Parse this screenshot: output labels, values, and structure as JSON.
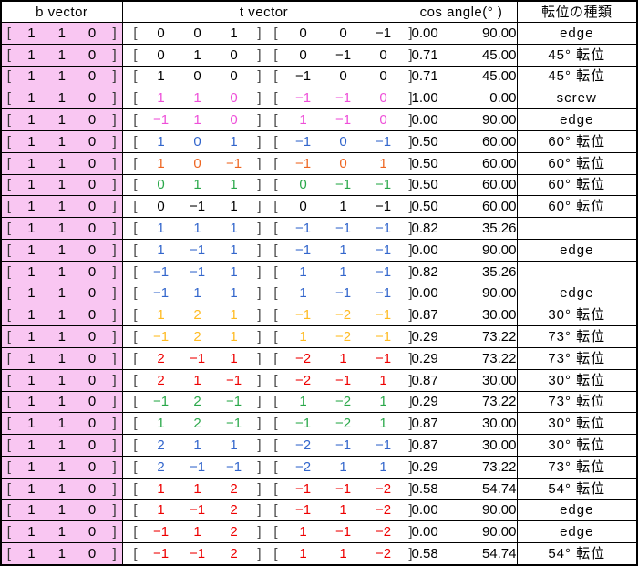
{
  "headers": {
    "b_vector": "b vector",
    "t_vector": "t vector",
    "cos_angle": "cos    angle(°   )",
    "kind": "転位の種類"
  },
  "colors": {
    "b_cell_background": "#f9c6f2",
    "black": "#000000",
    "magenta": "#ee4fd8",
    "blue": "#3366cc",
    "orange": "#ee6622",
    "green": "#2aa84a",
    "yellow": "#ffbb22",
    "red": "#ee0000"
  },
  "groups": [
    {
      "rows": [
        {
          "b": [
            "1",
            "1",
            "0"
          ],
          "t1": [
            "0",
            "0",
            "1"
          ],
          "t2": [
            "0",
            "0",
            "-1"
          ],
          "cos": "0.00",
          "angle": "90.00",
          "kind": "edge",
          "color": "k"
        },
        {
          "b": [
            "1",
            "1",
            "0"
          ],
          "t1": [
            "0",
            "1",
            "0"
          ],
          "t2": [
            "0",
            "-1",
            "0"
          ],
          "cos": "0.71",
          "angle": "45.00",
          "kind": "45°  転位",
          "color": "k"
        },
        {
          "b": [
            "1",
            "1",
            "0"
          ],
          "t1": [
            "1",
            "0",
            "0"
          ],
          "t2": [
            "-1",
            "0",
            "0"
          ],
          "cos": "0.71",
          "angle": "45.00",
          "kind": "45°  転位",
          "color": "k"
        }
      ]
    },
    {
      "rows": [
        {
          "b": [
            "1",
            "1",
            "0"
          ],
          "t1": [
            "1",
            "1",
            "0"
          ],
          "t2": [
            "-1",
            "-1",
            "0"
          ],
          "cos": "1.00",
          "angle": "0.00",
          "kind": "screw",
          "color": "mg"
        },
        {
          "b": [
            "1",
            "1",
            "0"
          ],
          "t1": [
            "-1",
            "1",
            "0"
          ],
          "t2": [
            "1",
            "-1",
            "0"
          ],
          "cos": "0.00",
          "angle": "90.00",
          "kind": "edge",
          "color": "mg"
        }
      ]
    },
    {
      "rows": [
        {
          "b": [
            "1",
            "1",
            "0"
          ],
          "t1": [
            "1",
            "0",
            "1"
          ],
          "t2": [
            "-1",
            "0",
            "-1"
          ],
          "cos": "0.50",
          "angle": "60.00",
          "kind": "60°  転位",
          "color": "bl"
        },
        {
          "b": [
            "1",
            "1",
            "0"
          ],
          "t1": [
            "1",
            "0",
            "-1"
          ],
          "t2": [
            "-1",
            "0",
            "1"
          ],
          "cos": "0.50",
          "angle": "60.00",
          "kind": "60°  転位",
          "color": "or"
        }
      ]
    },
    {
      "rows": [
        {
          "b": [
            "1",
            "1",
            "0"
          ],
          "t1": [
            "0",
            "1",
            "1"
          ],
          "t2": [
            "0",
            "-1",
            "-1"
          ],
          "cos": "0.50",
          "angle": "60.00",
          "kind": "60°  転位",
          "color": "gr"
        },
        {
          "b": [
            "1",
            "1",
            "0"
          ],
          "t1": [
            "0",
            "-1",
            "1"
          ],
          "t2": [
            "0",
            "1",
            "-1"
          ],
          "cos": "0.50",
          "angle": "60.00",
          "kind": "60°  転位",
          "color": "k"
        }
      ]
    },
    {
      "rows": [
        {
          "b": [
            "1",
            "1",
            "0"
          ],
          "t1": [
            "1",
            "1",
            "1"
          ],
          "t2": [
            "-1",
            "-1",
            "-1"
          ],
          "cos": "0.82",
          "angle": "35.26",
          "kind": "",
          "color": "bl"
        },
        {
          "b": [
            "1",
            "1",
            "0"
          ],
          "t1": [
            "1",
            "-1",
            "1"
          ],
          "t2": [
            "-1",
            "1",
            "-1"
          ],
          "cos": "0.00",
          "angle": "90.00",
          "kind": "edge",
          "color": "bl"
        },
        {
          "b": [
            "1",
            "1",
            "0"
          ],
          "t1": [
            "-1",
            "-1",
            "1"
          ],
          "t2": [
            "1",
            "1",
            "-1"
          ],
          "cos": "0.82",
          "angle": "35.26",
          "kind": "",
          "color": "bl"
        },
        {
          "b": [
            "1",
            "1",
            "0"
          ],
          "t1": [
            "-1",
            "1",
            "1"
          ],
          "t2": [
            "1",
            "-1",
            "-1"
          ],
          "cos": "0.00",
          "angle": "90.00",
          "kind": "edge",
          "color": "bl"
        }
      ]
    },
    {
      "rows": [
        {
          "b": [
            "1",
            "1",
            "0"
          ],
          "t1": [
            "1",
            "2",
            "1"
          ],
          "t2": [
            "-1",
            "-2",
            "-1"
          ],
          "cos": "0.87",
          "angle": "30.00",
          "kind": "30°  転位",
          "color": "ye"
        },
        {
          "b": [
            "1",
            "1",
            "0"
          ],
          "t1": [
            "-1",
            "2",
            "1"
          ],
          "t2": [
            "1",
            "-2",
            "-1"
          ],
          "cos": "0.29",
          "angle": "73.22",
          "kind": "73°  転位",
          "color": "ye"
        }
      ]
    },
    {
      "rows": [
        {
          "b": [
            "1",
            "1",
            "0"
          ],
          "t1": [
            "2",
            "-1",
            "1"
          ],
          "t2": [
            "-2",
            "1",
            "-1"
          ],
          "cos": "0.29",
          "angle": "73.22",
          "kind": "73°  転位",
          "color": "rd"
        },
        {
          "b": [
            "1",
            "1",
            "0"
          ],
          "t1": [
            "2",
            "1",
            "-1"
          ],
          "t2": [
            "-2",
            "-1",
            "1"
          ],
          "cos": "0.87",
          "angle": "30.00",
          "kind": "30°  転位",
          "color": "rd"
        }
      ]
    },
    {
      "rows": [
        {
          "b": [
            "1",
            "1",
            "0"
          ],
          "t1": [
            "-1",
            "2",
            "-1"
          ],
          "t2": [
            "1",
            "-2",
            "1"
          ],
          "cos": "0.29",
          "angle": "73.22",
          "kind": "73°  転位",
          "color": "gr"
        },
        {
          "b": [
            "1",
            "1",
            "0"
          ],
          "t1": [
            "1",
            "2",
            "-1"
          ],
          "t2": [
            "-1",
            "-2",
            "1"
          ],
          "cos": "0.87",
          "angle": "30.00",
          "kind": "30°  転位",
          "color": "gr"
        }
      ]
    },
    {
      "rows": [
        {
          "b": [
            "1",
            "1",
            "0"
          ],
          "t1": [
            "2",
            "1",
            "1"
          ],
          "t2": [
            "-2",
            "-1",
            "-1"
          ],
          "cos": "0.87",
          "angle": "30.00",
          "kind": "30°  転位",
          "color": "bl"
        },
        {
          "b": [
            "1",
            "1",
            "0"
          ],
          "t1": [
            "2",
            "-1",
            "-1"
          ],
          "t2": [
            "-2",
            "1",
            "1"
          ],
          "cos": "0.29",
          "angle": "73.22",
          "kind": "73°  転位",
          "color": "bl"
        }
      ]
    },
    {
      "rows": [
        {
          "b": [
            "1",
            "1",
            "0"
          ],
          "t1": [
            "1",
            "1",
            "2"
          ],
          "t2": [
            "-1",
            "-1",
            "-2"
          ],
          "cos": "0.58",
          "angle": "54.74",
          "kind": "54°  転位",
          "color": "rd"
        },
        {
          "b": [
            "1",
            "1",
            "0"
          ],
          "t1": [
            "1",
            "-1",
            "2"
          ],
          "t2": [
            "-1",
            "1",
            "-2"
          ],
          "cos": "0.00",
          "angle": "90.00",
          "kind": "edge",
          "color": "rd"
        },
        {
          "b": [
            "1",
            "1",
            "0"
          ],
          "t1": [
            "-1",
            "1",
            "2"
          ],
          "t2": [
            "1",
            "-1",
            "-2"
          ],
          "cos": "0.00",
          "angle": "90.00",
          "kind": "edge",
          "color": "rd"
        },
        {
          "b": [
            "1",
            "1",
            "0"
          ],
          "t1": [
            "-1",
            "-1",
            "2"
          ],
          "t2": [
            "1",
            "1",
            "-2"
          ],
          "cos": "0.58",
          "angle": "54.74",
          "kind": "54°  転位",
          "color": "rd"
        }
      ]
    }
  ]
}
